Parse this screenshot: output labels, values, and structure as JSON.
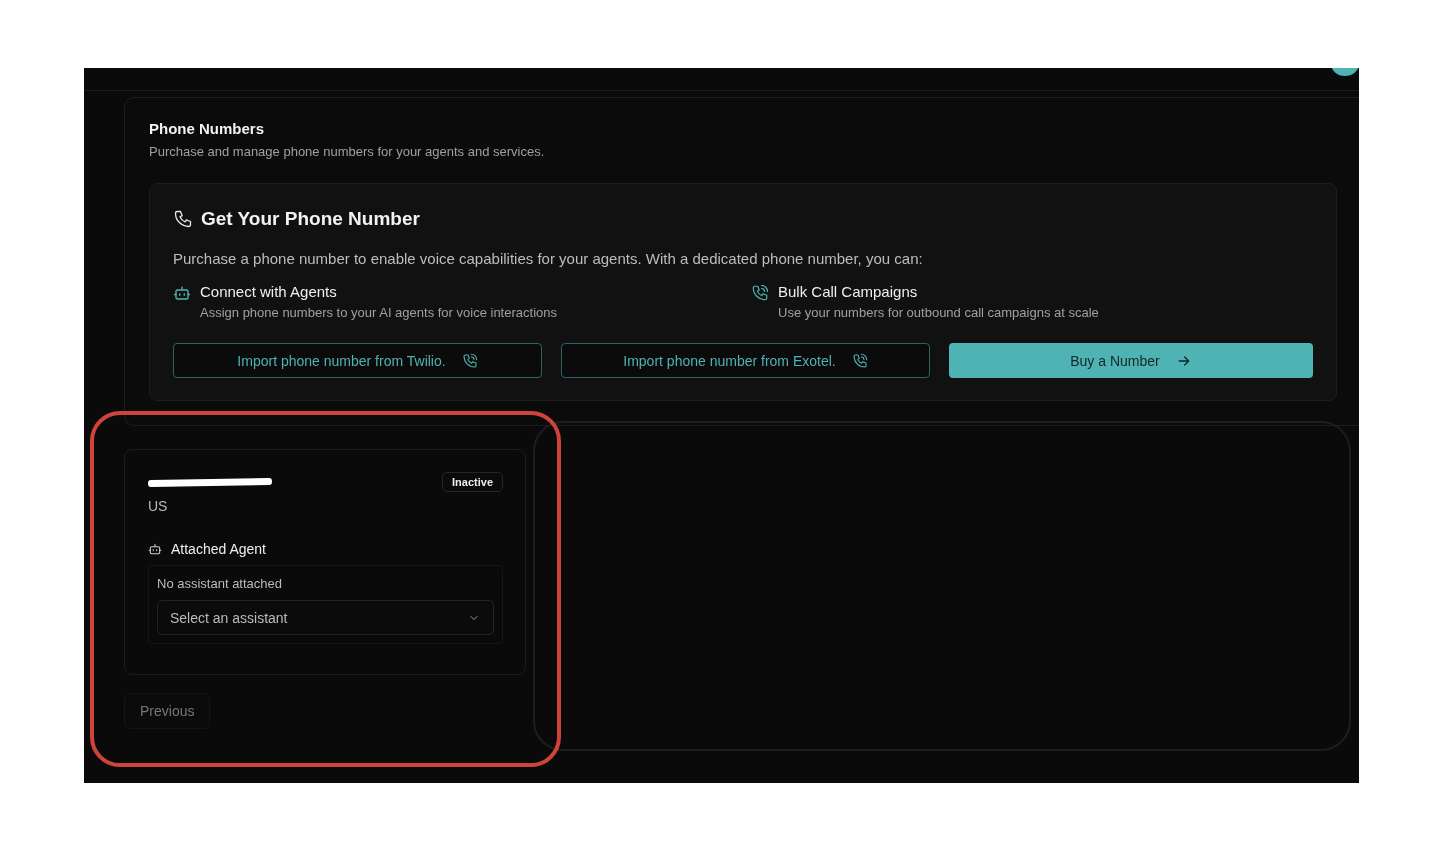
{
  "section": {
    "title": "Phone Numbers",
    "subtitle": "Purchase and manage phone numbers for your agents and services."
  },
  "get_number": {
    "title": "Get Your Phone Number",
    "description": "Purchase a phone number to enable voice capabilities for your agents. With a dedicated phone number, you can:",
    "features": [
      {
        "kind": "robot",
        "title": "Connect with Agents",
        "description": "Assign phone numbers to your AI agents for voice interactions"
      },
      {
        "kind": "phone",
        "title": "Bulk Call Campaigns",
        "description": "Use your numbers for outbound call campaigns at scale"
      }
    ],
    "buttons": [
      {
        "kind": "outline",
        "label": "Import phone number from Twilio."
      },
      {
        "kind": "outline",
        "label": "Import phone number from Exotel."
      },
      {
        "kind": "primary",
        "label": "Buy a Number"
      }
    ]
  },
  "numbers": [
    {
      "country": "US",
      "status": "Inactive",
      "agent_label": "Attached Agent",
      "agent_state": "No assistant attached",
      "select": {
        "placeholder": "Select an assistant"
      }
    }
  ],
  "pagination": {
    "previous": "Previous"
  }
}
